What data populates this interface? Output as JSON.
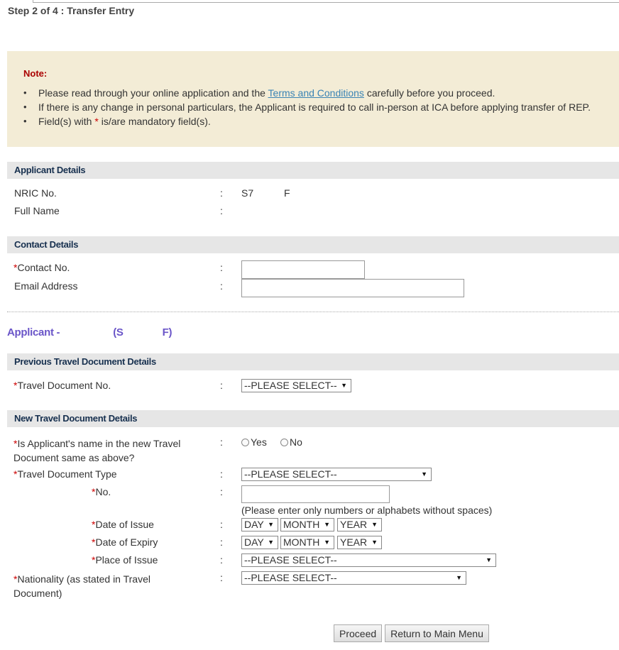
{
  "step": "Step 2 of 4 : Transfer Entry",
  "note": {
    "title": "Note:",
    "item1_before": "Please read through your online application and the ",
    "item1_link": "Terms and Conditions",
    "item1_after": " carefully before you proceed.",
    "item2": "If there is any change in personal particulars, the Applicant is required to call in-person at ICA before applying transfer of REP.",
    "item3_before": "Field(s) with ",
    "item3_star": "*",
    "item3_after": " is/are mandatory field(s)."
  },
  "applicant_details": {
    "header": "Applicant Details",
    "nric_label": "NRIC No.",
    "nric_value_start": "S7",
    "nric_value_end": "F",
    "fullname_label": "Full Name"
  },
  "contact_details": {
    "header": "Contact Details",
    "contact_label": "Contact No.",
    "email_label": "Email Address",
    "contact_value": "",
    "email_value": ""
  },
  "applicant_title": {
    "prefix": "Applicant -",
    "paren_open": "(S",
    "paren_close": "F)"
  },
  "previous_doc": {
    "header": "Previous Travel Document Details",
    "doc_no_label": "Travel Document No.",
    "doc_no_select": "--PLEASE SELECT--"
  },
  "new_doc": {
    "header": "New Travel Document Details",
    "same_name_label_line1": "Is Applicant's name in the new Travel",
    "same_name_label_line2": "Document same as above?",
    "yes": "Yes",
    "no": "No",
    "doc_type_label": "Travel Document Type",
    "doc_type_select": "--PLEASE SELECT--",
    "no_label": "No.",
    "no_hint": "(Please enter only numbers or alphabets without spaces)",
    "issue_label": "Date of Issue",
    "expiry_label": "Date of Expiry",
    "day": "DAY",
    "month": "MONTH",
    "year": "YEAR",
    "place_label": "Place of Issue",
    "place_select": "--PLEASE SELECT--",
    "nationality_label_line1": "Nationality (as stated in Travel",
    "nationality_label_line2": "Document)",
    "nationality_select": "--PLEASE SELECT--"
  },
  "colon": ":",
  "star": "*",
  "arrow": "▼",
  "buttons": {
    "proceed": "Proceed",
    "return": "Return to Main Menu"
  }
}
